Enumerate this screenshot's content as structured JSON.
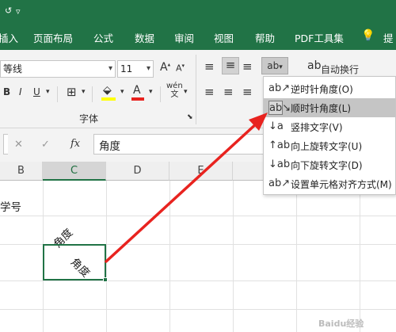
{
  "titlebar": {
    "qat_arrow": "▿",
    "qat_prev": "↺"
  },
  "tabs": [
    "插入",
    "页面布局",
    "公式",
    "数据",
    "审阅",
    "视图",
    "帮助",
    "PDF工具集",
    "提"
  ],
  "font": {
    "name": "等线",
    "size": "11",
    "group_label": "字体"
  },
  "alignment": {
    "wrap_text": "自动换行"
  },
  "formula_bar": {
    "fx": "fx",
    "cancel": "✕",
    "enter": "✓",
    "content": "角度"
  },
  "columns": [
    "B",
    "C",
    "D",
    "E"
  ],
  "cells": {
    "b_header": "学号",
    "c_angled": "角度",
    "c_selected": "角度"
  },
  "orientation_menu": {
    "items": [
      {
        "label": "逆时针角度(O)",
        "icon": "counterclockwise-icon"
      },
      {
        "label": "顺时针角度(L)",
        "icon": "clockwise-icon",
        "highlighted": true
      },
      {
        "label": "竖排文字(V)",
        "icon": "vertical-text-icon"
      },
      {
        "label": "向上旋转文字(U)",
        "icon": "rotate-up-icon"
      },
      {
        "label": "向下旋转文字(D)",
        "icon": "rotate-down-icon"
      },
      {
        "label": "设置单元格对齐方式(M)",
        "icon": "format-alignment-icon"
      }
    ]
  },
  "colors": {
    "ribbon_green": "#217346",
    "arrow_red": "#e8231f",
    "selection_green": "#217346"
  },
  "watermark": "Baidu经验"
}
